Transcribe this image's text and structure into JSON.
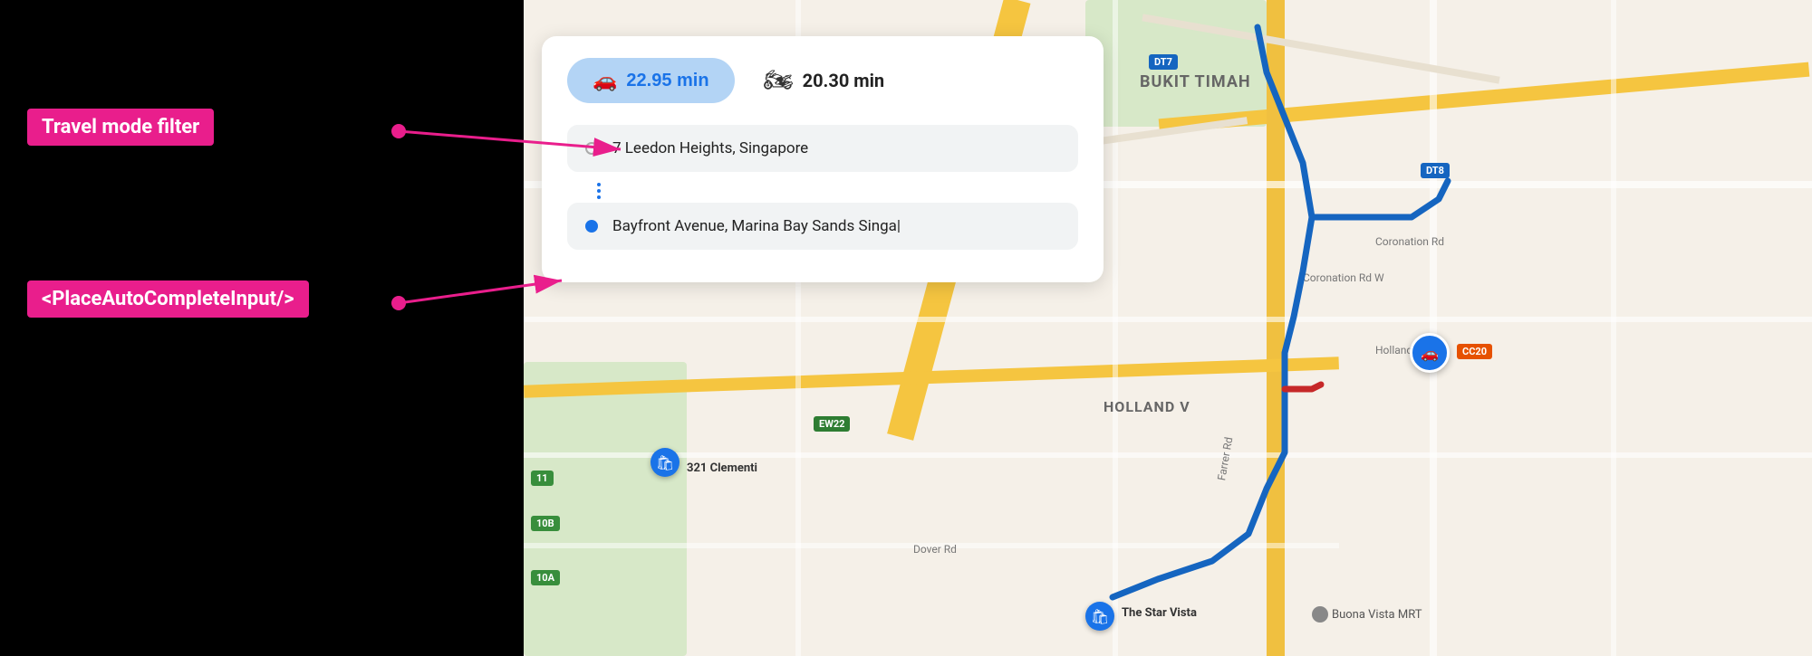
{
  "annotations": {
    "travel_mode_label": "Travel mode filter",
    "place_autocomplete_label": "<PlaceAutoCompleteInput/>"
  },
  "overlay": {
    "car_mode": {
      "icon": "🚗",
      "time": "22.95 min"
    },
    "moto_mode": {
      "icon": "🏍",
      "time": "20.30 min"
    },
    "origin_placeholder": "7 Leedon Heights, Singapore",
    "destination_placeholder": "Bayfront Avenue, Marina Bay Sands Singa|"
  },
  "map": {
    "labels": {
      "bukit_timah": "BUKIT TIMAH",
      "holland_v": "HOLLAND V",
      "the_star_vista": "The Star Vista",
      "buona_vista_mrt": "Buona Vista MRT",
      "clementi": "321 Clementi",
      "dover_rd": "Dover Rd"
    },
    "road_signs": {
      "dt7": "DT7",
      "dt8": "DT8",
      "ew22": "EW22",
      "cc20": "CC20",
      "r11": "11",
      "r10b": "10B",
      "r10a": "10A"
    },
    "roads": {
      "coronation_rd": "Coronation Rd",
      "coronation_rd_w": "Coronation Rd W",
      "farrer_rd": "Farrer Rd",
      "holland_rd": "Holland Rd"
    }
  },
  "colors": {
    "pink_annotation": "#e91e8c",
    "car_active_bg": "#b3d4f5",
    "car_active_text": "#1a73e8",
    "route_blue": "#1565c0",
    "route_red": "#c62828"
  }
}
